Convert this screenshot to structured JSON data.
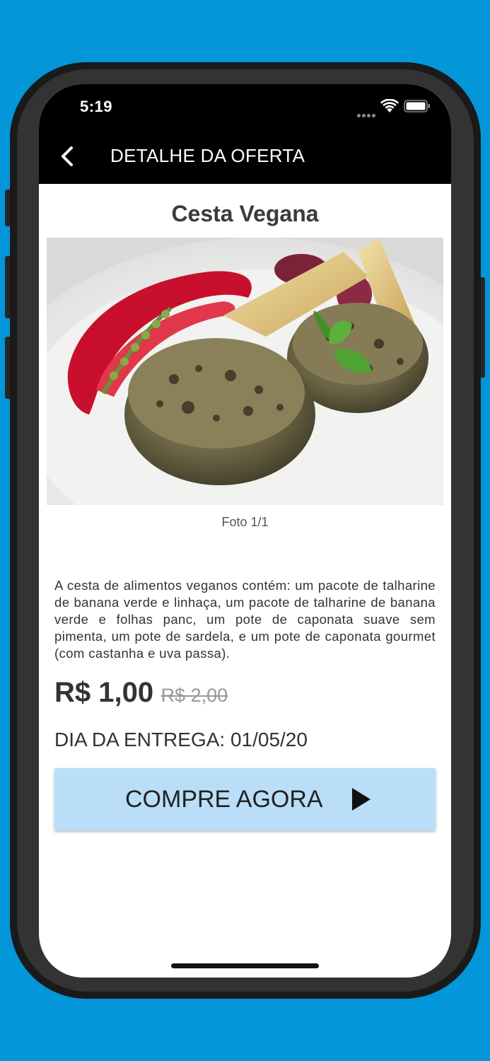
{
  "status_bar": {
    "time": "5:19"
  },
  "header": {
    "title": "DETALHE DA OFERTA"
  },
  "product": {
    "name": "Cesta Vegana",
    "photo_caption": "Foto 1/1",
    "description": "A cesta de alimentos veganos contém: um pacote de talharine de banana verde e linhaça, um pacote de talharine de banana verde e folhas panc, um pote de caponata suave sem pimenta, um pote de sardela, e um pote de caponata gourmet (com castanha e uva passa).",
    "price": "R$ 1,00",
    "old_price": "R$ 2,00",
    "delivery": "DIA DA ENTREGA: 01/05/20"
  },
  "actions": {
    "buy_label": "COMPRE AGORA"
  },
  "colors": {
    "background": "#0396D8",
    "header": "#000000",
    "button": "#BBDEF8"
  }
}
